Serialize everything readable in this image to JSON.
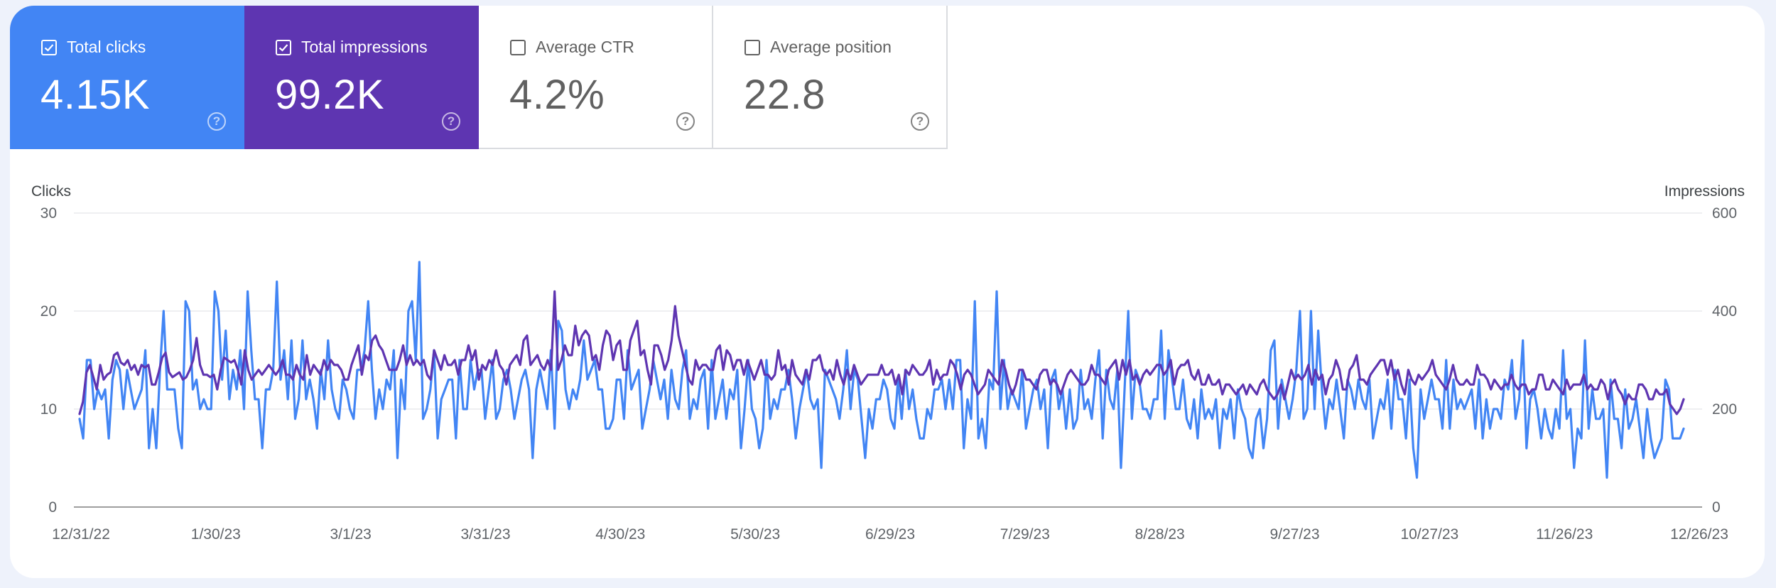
{
  "metrics": [
    {
      "label": "Total clicks",
      "value": "4.15K",
      "checked": true,
      "color": "#4285f4"
    },
    {
      "label": "Total impressions",
      "value": "99.2K",
      "checked": true,
      "color": "#5e35b1"
    },
    {
      "label": "Average CTR",
      "value": "4.2%",
      "checked": false
    },
    {
      "label": "Average position",
      "value": "22.8",
      "checked": false
    }
  ],
  "help_glyph": "?",
  "chart_data": {
    "type": "line",
    "left_axis": {
      "title": "Clicks",
      "ticks": [
        "0",
        "10",
        "20",
        "30"
      ],
      "ylim": [
        0,
        30
      ]
    },
    "right_axis": {
      "title": "Impressions",
      "ticks": [
        "0",
        "200",
        "400",
        "600"
      ],
      "ylim": [
        0,
        600
      ]
    },
    "x_ticks": [
      "12/31/22",
      "1/30/23",
      "3/1/23",
      "3/31/23",
      "4/30/23",
      "5/30/23",
      "6/29/23",
      "7/29/23",
      "8/28/23",
      "9/27/23",
      "10/27/23",
      "11/26/23",
      "12/26/23"
    ],
    "x_range": [
      "12/31/22",
      "12/31/23"
    ],
    "grid": true,
    "series": [
      {
        "name": "Clicks",
        "axis": "left",
        "color": "#4285f4",
        "values": [
          9,
          7,
          15,
          15,
          10,
          12,
          11,
          12,
          7,
          13,
          15,
          14,
          10,
          14,
          12,
          10,
          11,
          12,
          16,
          6,
          10,
          6,
          14,
          20,
          12,
          12,
          12,
          8,
          6,
          21,
          20,
          12,
          13,
          10,
          11,
          10,
          10,
          22,
          20,
          13,
          18,
          11,
          14,
          12,
          16,
          10,
          22,
          16,
          11,
          11,
          6,
          12,
          12,
          14,
          23,
          13,
          16,
          11,
          17,
          9,
          11,
          17,
          11,
          13,
          11,
          8,
          14,
          11,
          17,
          12,
          10,
          9,
          13,
          12,
          10,
          9,
          14,
          14,
          16,
          21,
          14,
          9,
          12,
          10,
          13,
          12,
          16,
          5,
          13,
          10,
          20,
          21,
          15,
          25,
          9,
          10,
          12,
          16,
          7,
          11,
          12,
          13,
          13,
          7,
          15,
          10,
          10,
          15,
          12,
          14,
          14,
          9,
          12,
          15,
          9,
          10,
          13,
          14,
          12,
          9,
          11,
          13,
          14,
          12,
          5,
          12,
          14,
          12,
          10,
          16,
          8,
          19,
          18,
          12,
          10,
          12,
          11,
          13,
          17,
          13,
          14,
          15,
          12,
          12,
          8,
          8,
          9,
          13,
          13,
          9,
          16,
          12,
          13,
          14,
          8,
          10,
          12,
          15,
          13,
          11,
          13,
          9,
          14,
          11,
          10,
          14,
          16,
          9,
          11,
          10,
          13,
          14,
          8,
          15,
          9,
          11,
          13,
          9,
          12,
          11,
          14,
          6,
          10,
          15,
          10,
          9,
          6,
          8,
          15,
          9,
          11,
          10,
          12,
          12,
          14,
          11,
          7,
          10,
          12,
          14,
          11,
          10,
          11,
          4,
          14,
          13,
          12,
          11,
          9,
          12,
          16,
          10,
          14,
          13,
          9,
          5,
          10,
          8,
          11,
          11,
          13,
          12,
          9,
          8,
          13,
          9,
          14,
          10,
          12,
          9,
          7,
          7,
          10,
          9,
          12,
          12,
          13,
          10,
          13,
          10,
          15,
          15,
          6,
          11,
          9,
          21,
          7,
          9,
          6,
          13,
          12,
          22,
          10,
          15,
          10,
          12,
          11,
          10,
          14,
          8,
          10,
          12,
          13,
          10,
          12,
          6,
          13,
          14,
          10,
          12,
          8,
          12,
          8,
          9,
          14,
          10,
          11,
          9,
          13,
          16,
          7,
          14,
          11,
          10,
          14,
          4,
          12,
          20,
          9,
          14,
          13,
          10,
          10,
          9,
          11,
          11,
          18,
          9,
          16,
          13,
          10,
          10,
          13,
          9,
          8,
          11,
          7,
          12,
          9,
          10,
          9,
          11,
          6,
          10,
          9,
          11,
          7,
          12,
          10,
          9,
          6,
          5,
          9,
          10,
          6,
          9,
          16,
          17,
          8,
          13,
          11,
          9,
          11,
          14,
          20,
          9,
          10,
          20,
          10,
          18,
          12,
          8,
          11,
          10,
          13,
          10,
          7,
          13,
          12,
          10,
          13,
          11,
          10,
          13,
          7,
          9,
          11,
          10,
          13,
          8,
          14,
          11,
          11,
          7,
          13,
          6,
          3,
          12,
          9,
          11,
          13,
          11,
          11,
          8,
          15,
          8,
          13,
          10,
          11,
          10,
          11,
          12,
          8,
          13,
          7,
          11,
          8,
          10,
          10,
          9,
          13,
          12,
          15,
          9,
          11,
          17,
          6,
          11,
          12,
          10,
          7,
          10,
          8,
          7,
          10,
          8,
          16,
          9,
          10,
          4,
          8,
          7,
          17,
          8,
          12,
          9,
          9,
          10,
          3,
          13,
          9,
          9,
          6,
          12,
          8,
          9,
          11,
          8,
          5,
          10,
          7,
          5,
          6,
          7,
          13,
          12,
          7,
          7,
          7,
          8
        ]
      },
      {
        "name": "Impressions",
        "axis": "right",
        "color": "#5e35b1",
        "values": [
          190,
          215,
          275,
          290,
          265,
          240,
          290,
          260,
          270,
          275,
          310,
          315,
          295,
          290,
          300,
          280,
          290,
          270,
          290,
          285,
          290,
          250,
          250,
          275,
          305,
          315,
          275,
          265,
          270,
          275,
          260,
          265,
          280,
          300,
          345,
          290,
          270,
          270,
          265,
          270,
          240,
          280,
          305,
          300,
          295,
          300,
          280,
          250,
          320,
          280,
          260,
          270,
          280,
          270,
          280,
          290,
          280,
          270,
          280,
          300,
          270,
          270,
          260,
          290,
          270,
          260,
          310,
          270,
          290,
          280,
          270,
          300,
          280,
          300,
          290,
          290,
          280,
          260,
          260,
          290,
          310,
          330,
          270,
          310,
          300,
          340,
          350,
          330,
          320,
          300,
          280,
          280,
          280,
          300,
          330,
          290,
          310,
          290,
          300,
          290,
          300,
          270,
          260,
          320,
          300,
          280,
          310,
          290,
          290,
          300,
          270,
          300,
          300,
          330,
          300,
          320,
          260,
          290,
          280,
          300,
          290,
          320,
          290,
          280,
          250,
          290,
          300,
          310,
          290,
          340,
          350,
          290,
          300,
          310,
          290,
          280,
          300,
          280,
          440,
          280,
          300,
          330,
          310,
          310,
          370,
          330,
          350,
          360,
          350,
          300,
          310,
          280,
          330,
          360,
          350,
          300,
          330,
          340,
          280,
          280,
          340,
          360,
          380,
          310,
          320,
          280,
          250,
          330,
          330,
          310,
          280,
          300,
          340,
          410,
          350,
          320,
          290,
          260,
          250,
          300,
          280,
          290,
          290,
          280,
          280,
          320,
          330,
          280,
          320,
          310,
          280,
          300,
          300,
          270,
          300,
          280,
          260,
          280,
          300,
          270,
          270,
          260,
          270,
          320,
          280,
          290,
          250,
          300,
          270,
          260,
          250,
          280,
          260,
          300,
          300,
          310,
          280,
          270,
          280,
          260,
          300,
          270,
          250,
          280,
          260,
          290,
          270,
          250,
          260,
          270,
          270,
          270,
          270,
          290,
          270,
          270,
          280,
          250,
          270,
          230,
          280,
          270,
          290,
          280,
          270,
          270,
          280,
          300,
          250,
          280,
          260,
          270,
          270,
          300,
          290,
          270,
          240,
          270,
          280,
          270,
          250,
          230,
          240,
          250,
          280,
          270,
          260,
          250,
          300,
          280,
          250,
          230,
          250,
          280,
          280,
          260,
          260,
          250,
          240,
          270,
          280,
          280,
          250,
          260,
          250,
          230,
          250,
          270,
          280,
          270,
          260,
          250,
          250,
          260,
          290,
          270,
          270,
          260,
          250,
          280,
          290,
          300,
          260,
          300,
          270,
          300,
          260,
          270,
          250,
          270,
          280,
          270,
          280,
          290,
          290,
          270,
          280,
          300,
          250,
          280,
          290,
          290,
          300,
          270,
          260,
          280,
          250,
          250,
          270,
          250,
          250,
          260,
          230,
          250,
          250,
          240,
          230,
          240,
          250,
          230,
          250,
          240,
          230,
          250,
          260,
          240,
          230,
          220,
          230,
          250,
          220,
          250,
          280,
          260,
          270,
          260,
          270,
          290,
          250,
          280,
          260,
          270,
          230,
          260,
          270,
          300,
          280,
          240,
          240,
          280,
          290,
          310,
          260,
          260,
          250,
          270,
          280,
          290,
          300,
          300,
          270,
          300,
          260,
          280,
          250,
          230,
          280,
          260,
          250,
          270,
          260,
          270,
          280,
          300,
          270,
          260,
          250,
          240,
          260,
          290,
          260,
          250,
          250,
          260,
          250,
          250,
          290,
          270,
          270,
          260,
          240,
          260,
          250,
          240,
          250,
          250,
          270,
          250,
          240,
          250,
          250,
          230,
          240,
          240,
          270,
          270,
          240,
          240,
          260,
          250,
          240,
          230,
          260,
          240,
          250,
          250,
          250,
          270,
          240,
          250,
          240,
          240,
          260,
          250,
          220,
          250,
          260,
          240,
          230,
          210,
          230,
          220,
          220,
          250,
          250,
          240,
          220,
          220,
          240,
          230,
          230,
          240,
          210,
          200,
          190,
          200,
          220
        ]
      }
    ]
  }
}
